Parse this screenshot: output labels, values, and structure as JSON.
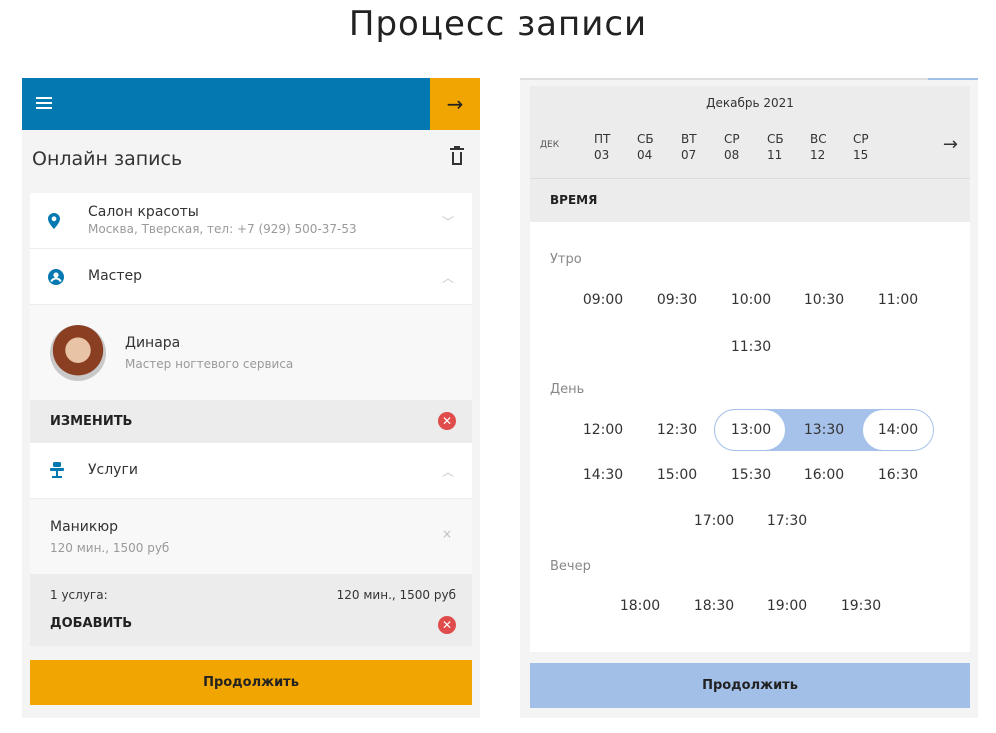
{
  "page_title": "Процесс записи",
  "left": {
    "next_arrow": "→",
    "title": "Онлайн запись",
    "salon": {
      "label": "Салон красоты",
      "sub": "Москва, Тверская, тел: +7 (929) 500-37-53"
    },
    "master": {
      "label": "Мастер",
      "name": "Динара",
      "role": "Мастер ногтевого сервиса"
    },
    "change_label": "ИЗМЕНИТЬ",
    "services": {
      "label": "Услуги"
    },
    "service_item": {
      "name": "Маникюр",
      "sub": "120 мин., 1500 руб",
      "remove": "×"
    },
    "summary": {
      "count": "1 услуга:",
      "value": "120 мин., 1500 руб",
      "add": "ДОБАВИТЬ"
    },
    "continue": "Продолжить"
  },
  "right": {
    "month": "Декабрь 2021",
    "dek": "ДЕК",
    "days": [
      {
        "dow": "ПТ",
        "date": "03"
      },
      {
        "dow": "СБ",
        "date": "04"
      },
      {
        "dow": "ВТ",
        "date": "07"
      },
      {
        "dow": "СР",
        "date": "08"
      },
      {
        "dow": "СБ",
        "date": "11"
      },
      {
        "dow": "ВС",
        "date": "12"
      },
      {
        "dow": "СР",
        "date": "15"
      }
    ],
    "next_arrow": "→",
    "time_label": "ВРЕМЯ",
    "periods": {
      "morning": "Утро",
      "day": "День",
      "evening": "Вечер"
    },
    "morning": [
      "09:00",
      "09:30",
      "10:00",
      "10:30",
      "11:00",
      "11:30"
    ],
    "day": [
      "12:00",
      "12:30",
      "13:00",
      "13:30",
      "14:00",
      "14:30",
      "15:00",
      "15:30",
      "16:00",
      "16:30",
      "17:00",
      "17:30"
    ],
    "evening": [
      "18:00",
      "18:30",
      "19:00",
      "19:30"
    ],
    "continue": "Продолжить"
  }
}
